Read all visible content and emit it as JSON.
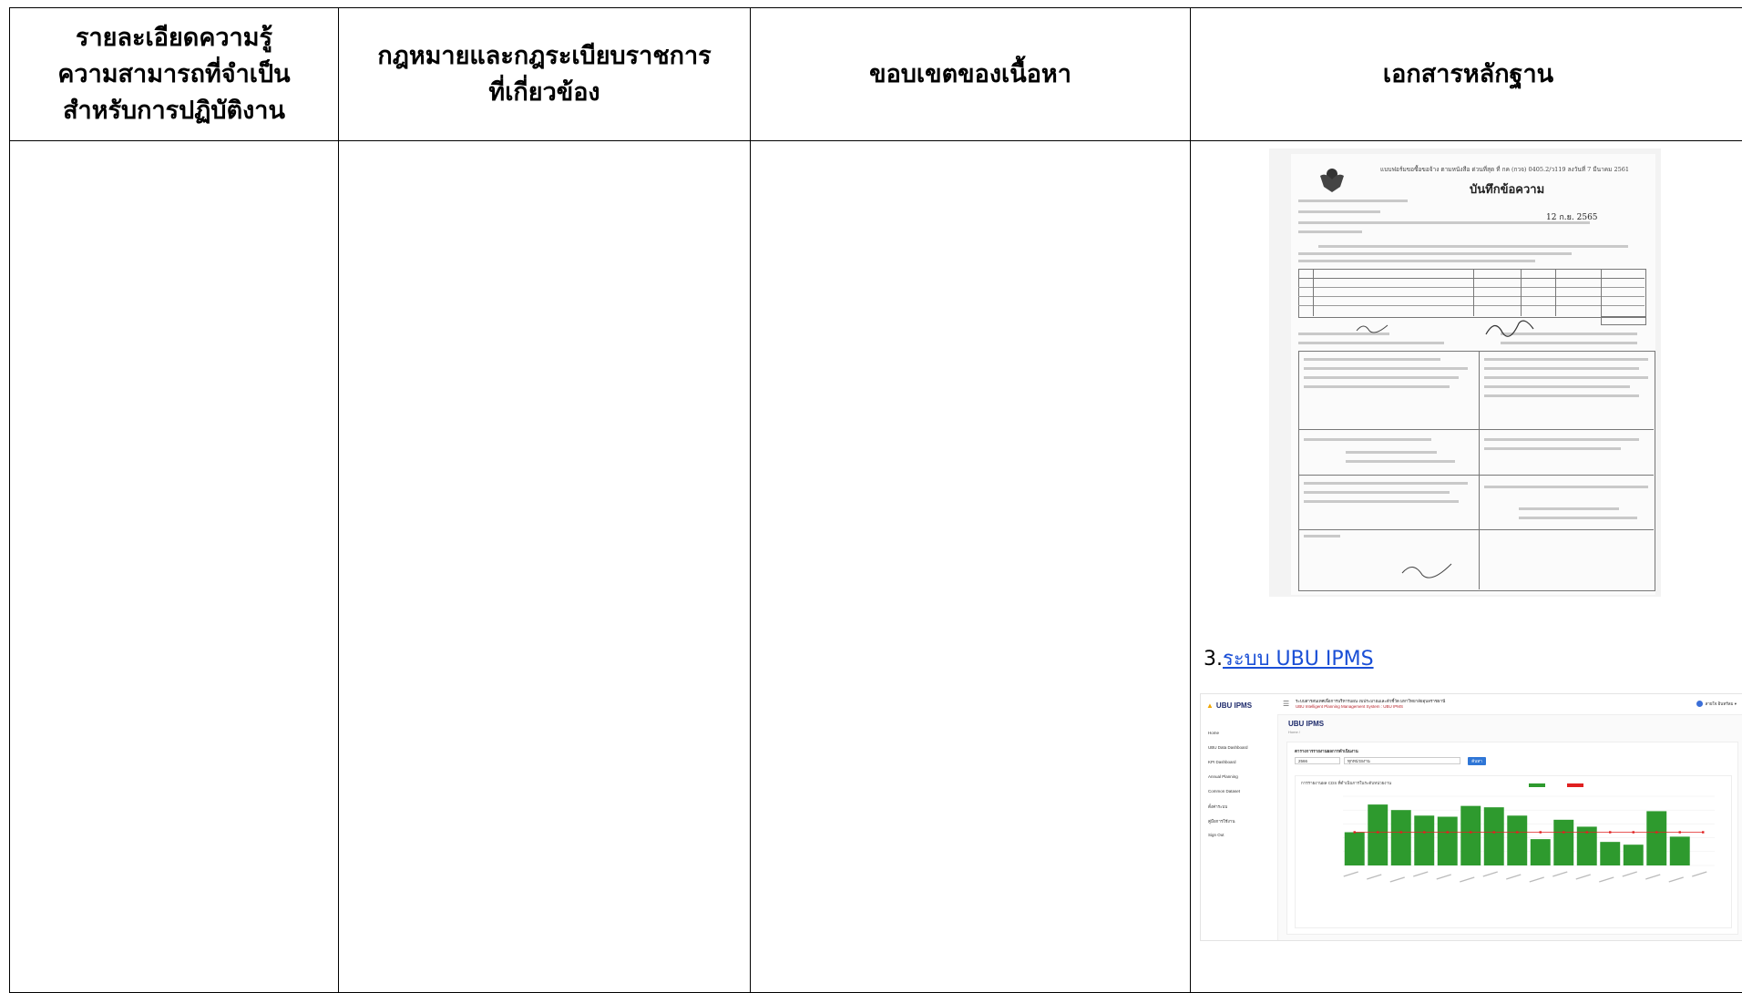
{
  "headers": [
    "รายละเอียดความรู้ ความสามารถที่จำเป็น สำหรับการปฏิบัติงาน",
    "กฎหมายและกฎระเบียบราชการ ที่เกี่ยวข้อง",
    "ขอบเขตของเนื้อหา",
    "เอกสารหลักฐาน"
  ],
  "header_lines": {
    "col1": [
      "รายละเอียดความรู้",
      "ความสามารถที่จำเป็น",
      "สำหรับการปฏิบัติงาน"
    ],
    "col2": [
      "กฎหมายและกฎระเบียบราชการ",
      "ที่เกี่ยวข้อง"
    ]
  },
  "memo": {
    "top_line": "แบบฟอร์มขอซื้อขอจ้าง ตามหนังสือ ด่วนที่สุด ที่ กค (กวจ) 0405.2/ว119 ลงวันที่ 7 มีนาคม 2561",
    "title": "บันทึกข้อความ",
    "date": "12 ก.ย. 2565"
  },
  "evidence_link": {
    "prefix": "3.",
    "text": "ระบบ UBU IPMS"
  },
  "dashboard": {
    "logo": "UBU IPMS",
    "top_line1": "ระบบสารสนเทศเพื่อการบริหารแผน งบประมาณและตัวชี้วัด มหาวิทยาลัยอุบลราชธานี",
    "top_line2": "UBU Intelligent Planning Management System : UBU IPMS",
    "user": "สายใจ อินทร์ลม",
    "page_title": "UBU IPMS",
    "breadcrumb": "Home /",
    "sidebar": [
      "Home",
      "UBU Data Dashboard",
      "KPI Dashboard",
      "Annual Planning",
      "Common Dataset",
      "ตั้งค่าระบบ",
      "คู่มือการใช้งาน",
      "Sign Out"
    ],
    "filter_label": "ตารางการรายงานผลการดำเนินงาน",
    "year_value": "2566",
    "unit_value": "ทุกหน่วยงาน",
    "search_button": "ค้นหา",
    "chart_title": "การรายงานผล CDS ที่ดำเนินการในระดับหน่วยงาน",
    "colors": {
      "bar": "#2e9a2e",
      "target": "#e02020",
      "accent": "#1d2a6b"
    }
  },
  "chart_data": {
    "type": "bar",
    "title": "การรายงานผล CDS ที่ดำเนินการในระดับหน่วยงาน",
    "legend_position": "top",
    "categories": [
      "c1",
      "c2",
      "c3",
      "c4",
      "c5",
      "c6",
      "c7",
      "c8",
      "c9",
      "c10",
      "c11",
      "c12",
      "c13",
      "c14",
      "c15",
      "c16"
    ],
    "series": [
      {
        "values": [
          120,
          220,
          200,
          180,
          176,
          215,
          210,
          180,
          95,
          165,
          140,
          85,
          75,
          196,
          104,
          0
        ]
      },
      {
        "values": [
          120,
          120,
          120,
          120,
          120,
          120,
          120,
          120,
          120,
          120,
          120,
          120,
          120,
          120,
          120,
          120
        ]
      }
    ],
    "ylim": [
      0,
      250
    ]
  }
}
